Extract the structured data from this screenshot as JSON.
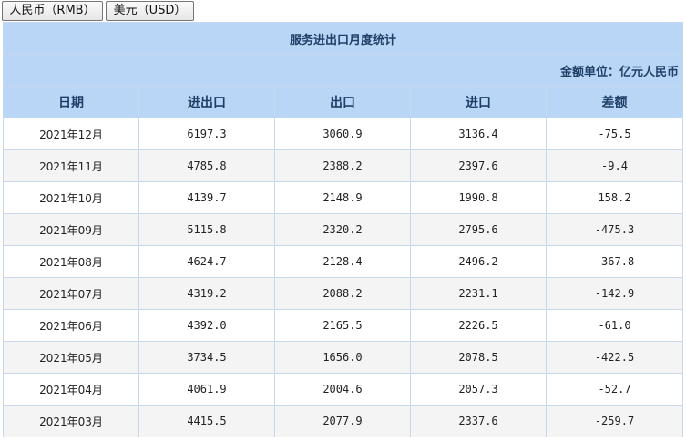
{
  "currency_buttons": {
    "rmb_label": "人民币（RMB）",
    "usd_label": "美元（USD）"
  },
  "table": {
    "title": "服务进出口月度统计",
    "unit": "金额单位：亿元人民币",
    "headers": [
      "日期",
      "进出口",
      "出口",
      "进口",
      "差额"
    ],
    "rows": [
      [
        "2021年12月",
        "6197.3",
        "3060.9",
        "3136.4",
        "-75.5"
      ],
      [
        "2021年11月",
        "4785.8",
        "2388.2",
        "2397.6",
        "-9.4"
      ],
      [
        "2021年10月",
        "4139.7",
        "2148.9",
        "1990.8",
        "158.2"
      ],
      [
        "2021年09月",
        "5115.8",
        "2320.2",
        "2795.6",
        "-475.3"
      ],
      [
        "2021年08月",
        "4624.7",
        "2128.4",
        "2496.2",
        "-367.8"
      ],
      [
        "2021年07月",
        "4319.2",
        "2088.2",
        "2231.1",
        "-142.9"
      ],
      [
        "2021年06月",
        "4392.0",
        "2165.5",
        "2226.5",
        "-61.0"
      ],
      [
        "2021年05月",
        "3734.5",
        "1656.0",
        "2078.5",
        "-422.5"
      ],
      [
        "2021年04月",
        "4061.9",
        "2004.6",
        "2057.3",
        "-52.7"
      ],
      [
        "2021年03月",
        "4415.5",
        "2077.9",
        "2337.6",
        "-259.7"
      ]
    ]
  },
  "colors": {
    "header_bg": "#b9d6f7",
    "header_text": "#1f3f66",
    "row_alt_bg": "#f4f4f4",
    "border": "#c6d8ec"
  }
}
